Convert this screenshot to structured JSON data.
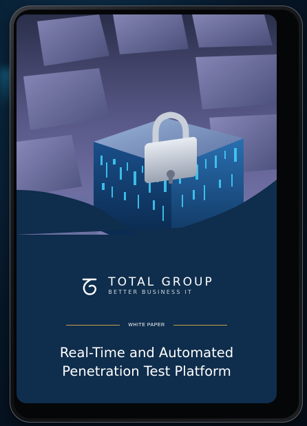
{
  "brand": {
    "name": "TOTAL GROUP",
    "tagline": "BETTER BUSINESS IT",
    "logo_icon": "tg-monogram-icon",
    "accent_color": "#c9a24a"
  },
  "document": {
    "label": "WHITE PAPER",
    "title_line_1": "Real-Time and Automated",
    "title_line_2": "Penetration Test Platform",
    "background_color": "#0f2d4c"
  },
  "hero": {
    "icon": "padlock-icon",
    "description_icon": "data-cube-icon"
  }
}
